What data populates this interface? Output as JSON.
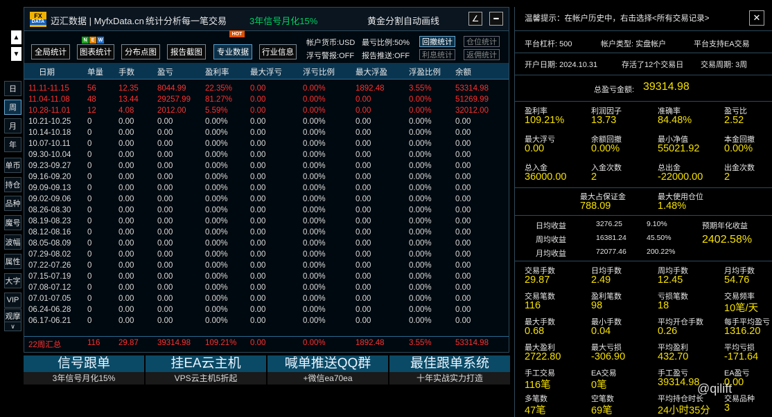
{
  "left_nav": {
    "up": "▲",
    "down": "▼",
    "buttons": [
      "日",
      "周",
      "月",
      "年",
      "单币",
      "持仓",
      "品种",
      "魔号",
      "波幅",
      "属性",
      "大字",
      "VIP",
      "观摩"
    ],
    "more": "∨"
  },
  "title": {
    "logo_top": "FX",
    "logo_bottom": "DATA",
    "app": "迈汇数据 | MyfxData.cn",
    "tagline": "统计分析每一笔交易",
    "promo": "3年信号月化15%",
    "gold": "黄金分割自动画线",
    "btn_edit": "∠",
    "btn_min": "━"
  },
  "tabs": [
    "全局统计",
    "图表统计",
    "分布点图",
    "报告截图",
    "专业数据",
    "行业信息"
  ],
  "badges": {
    "n": "N",
    "e": "E",
    "w": "W",
    "hot": "HOT"
  },
  "info": {
    "currency": "帐户货币:USD",
    "max_loss": "最亏比例:50%",
    "float_warn": "浮亏警报:OFF",
    "report_push": "报告推送:OFF"
  },
  "opt_buttons": [
    "回撤统计",
    "仓位统计",
    "利息统计",
    "返佣统计"
  ],
  "table": {
    "headers": [
      "日期",
      "单量",
      "手数",
      "盈亏",
      "盈利率",
      "最大浮亏",
      "浮亏比例",
      "最大浮盈",
      "浮盈比例",
      "余额"
    ],
    "rows": [
      [
        "11.11-11.15",
        "56",
        "12.35",
        "8044.99",
        "22.35%",
        "0.00",
        "0.00%",
        "1892.48",
        "3.55%",
        "53314.98"
      ],
      [
        "11.04-11.08",
        "48",
        "13.44",
        "29257.99",
        "81.27%",
        "0.00",
        "0.00%",
        "0.00",
        "0.00%",
        "51269.99"
      ],
      [
        "10.28-11.01",
        "12",
        "4.08",
        "2012.00",
        "5.59%",
        "0.00",
        "0.00%",
        "0.00",
        "0.00%",
        "32012.00"
      ],
      [
        "10.21-10.25",
        "0",
        "0.00",
        "0.00",
        "0.00%",
        "0.00",
        "0.00%",
        "0.00",
        "0.00%",
        "0.00"
      ],
      [
        "10.14-10.18",
        "0",
        "0.00",
        "0.00",
        "0.00%",
        "0.00",
        "0.00%",
        "0.00",
        "0.00%",
        "0.00"
      ],
      [
        "10.07-10.11",
        "0",
        "0.00",
        "0.00",
        "0.00%",
        "0.00",
        "0.00%",
        "0.00",
        "0.00%",
        "0.00"
      ],
      [
        "09.30-10.04",
        "0",
        "0.00",
        "0.00",
        "0.00%",
        "0.00",
        "0.00%",
        "0.00",
        "0.00%",
        "0.00"
      ],
      [
        "09.23-09.27",
        "0",
        "0.00",
        "0.00",
        "0.00%",
        "0.00",
        "0.00%",
        "0.00",
        "0.00%",
        "0.00"
      ],
      [
        "09.16-09.20",
        "0",
        "0.00",
        "0.00",
        "0.00%",
        "0.00",
        "0.00%",
        "0.00",
        "0.00%",
        "0.00"
      ],
      [
        "09.09-09.13",
        "0",
        "0.00",
        "0.00",
        "0.00%",
        "0.00",
        "0.00%",
        "0.00",
        "0.00%",
        "0.00"
      ],
      [
        "09.02-09.06",
        "0",
        "0.00",
        "0.00",
        "0.00%",
        "0.00",
        "0.00%",
        "0.00",
        "0.00%",
        "0.00"
      ],
      [
        "08.26-08.30",
        "0",
        "0.00",
        "0.00",
        "0.00%",
        "0.00",
        "0.00%",
        "0.00",
        "0.00%",
        "0.00"
      ],
      [
        "08.19-08.23",
        "0",
        "0.00",
        "0.00",
        "0.00%",
        "0.00",
        "0.00%",
        "0.00",
        "0.00%",
        "0.00"
      ],
      [
        "08.12-08.16",
        "0",
        "0.00",
        "0.00",
        "0.00%",
        "0.00",
        "0.00%",
        "0.00",
        "0.00%",
        "0.00"
      ],
      [
        "08.05-08.09",
        "0",
        "0.00",
        "0.00",
        "0.00%",
        "0.00",
        "0.00%",
        "0.00",
        "0.00%",
        "0.00"
      ],
      [
        "07.29-08.02",
        "0",
        "0.00",
        "0.00",
        "0.00%",
        "0.00",
        "0.00%",
        "0.00",
        "0.00%",
        "0.00"
      ],
      [
        "07.22-07.26",
        "0",
        "0.00",
        "0.00",
        "0.00%",
        "0.00",
        "0.00%",
        "0.00",
        "0.00%",
        "0.00"
      ],
      [
        "07.15-07.19",
        "0",
        "0.00",
        "0.00",
        "0.00%",
        "0.00",
        "0.00%",
        "0.00",
        "0.00%",
        "0.00"
      ],
      [
        "07.08-07.12",
        "0",
        "0.00",
        "0.00",
        "0.00%",
        "0.00",
        "0.00%",
        "0.00",
        "0.00%",
        "0.00"
      ],
      [
        "07.01-07.05",
        "0",
        "0.00",
        "0.00",
        "0.00%",
        "0.00",
        "0.00%",
        "0.00",
        "0.00%",
        "0.00"
      ],
      [
        "06.24-06.28",
        "0",
        "0.00",
        "0.00",
        "0.00%",
        "0.00",
        "0.00%",
        "0.00",
        "0.00%",
        "0.00"
      ],
      [
        "06.17-06.21",
        "0",
        "0.00",
        "0.00",
        "0.00%",
        "0.00",
        "0.00%",
        "0.00",
        "0.00%",
        "0.00"
      ]
    ],
    "total": [
      "22周汇总",
      "116",
      "29.87",
      "39314.98",
      "109.21%",
      "0.00",
      "0.00%",
      "1892.48",
      "3.55%",
      "53314.98"
    ]
  },
  "promos": [
    {
      "title": "信号跟单",
      "sub": "3年信号月化15%"
    },
    {
      "title": "挂EA云主机",
      "sub": "VPS云主机5折起"
    },
    {
      "title": "喊单推送QQ群",
      "sub": "+微信ea70ea"
    },
    {
      "title": "最佳跟单系统",
      "sub": "十年实战实力打造"
    }
  ],
  "right": {
    "tip": "温馨提示：在帐户历史中，右击选择<所有交易记录>",
    "close": "✕",
    "leverage": "平台杠杆:  500",
    "acct_type": "帐户类型:  实盘帐户",
    "ea_support": "平台支持EA交易",
    "open_date": "开户日期:  2024.10.31",
    "trade_days": "存活了12个交易日",
    "period": "交易周期:  3周",
    "total_pl_label": "总盈亏金额:",
    "total_pl": "39314.98",
    "grid1": [
      {
        "label": "盈利率",
        "value": "109.21%"
      },
      {
        "label": "利润因子",
        "value": "13.73"
      },
      {
        "label": "准确率",
        "value": "84.48%"
      },
      {
        "label": "盈亏比",
        "value": "2.52"
      },
      {
        "label": "最大浮亏",
        "value": "0.00"
      },
      {
        "label": "余额回撤",
        "value": "0.00%"
      },
      {
        "label": "最小净值",
        "value": "55021.92"
      },
      {
        "label": "本金回撤",
        "value": "0.00%"
      },
      {
        "label": "总入金",
        "value": "36000.00"
      },
      {
        "label": "入金次数",
        "value": "2"
      },
      {
        "label": "总出金",
        "value": "-22000.00"
      },
      {
        "label": "出金次数",
        "value": "2"
      }
    ],
    "margin": [
      {
        "label": "最大占保证金",
        "value": "788.09"
      },
      {
        "label": "最大使用仓位",
        "value": "1.48%"
      }
    ],
    "returns": [
      {
        "label": "日均收益",
        "amount": "3276.25",
        "pct": "9.10%"
      },
      {
        "label": "周均收益",
        "amount": "16381.24",
        "pct": "45.50%"
      },
      {
        "label": "月均收益",
        "amount": "72077.46",
        "pct": "200.22%"
      }
    ],
    "annual_label": "预期年化收益",
    "annual": "2402.58%",
    "grid2": [
      {
        "label": "交易手数",
        "value": "29.87"
      },
      {
        "label": "日均手数",
        "value": "2.49"
      },
      {
        "label": "周均手数",
        "value": "12.45"
      },
      {
        "label": "月均手数",
        "value": "54.76"
      },
      {
        "label": "交易笔数",
        "value": "116"
      },
      {
        "label": "盈利笔数",
        "value": "98"
      },
      {
        "label": "亏损笔数",
        "value": "18"
      },
      {
        "label": "交易频率",
        "value": "10笔/天"
      },
      {
        "label": "最大手数",
        "value": "0.68"
      },
      {
        "label": "最小手数",
        "value": "0.04"
      },
      {
        "label": "平均开仓手数",
        "value": "0.26"
      },
      {
        "label": "每手平均盈亏",
        "value": "1316.20"
      },
      {
        "label": "最大盈利",
        "value": "2722.80"
      },
      {
        "label": "最大亏损",
        "value": "-306.90"
      },
      {
        "label": "平均盈利",
        "value": "432.70"
      },
      {
        "label": "平均亏损",
        "value": "-171.64"
      },
      {
        "label": "手工交易",
        "value": "116笔"
      },
      {
        "label": "EA交易",
        "value": "0笔"
      },
      {
        "label": "手工盈亏",
        "value": "39314.98"
      },
      {
        "label": "EA盈亏",
        "value": "0.00"
      },
      {
        "label": "多笔数",
        "value": "47笔"
      },
      {
        "label": "空笔数",
        "value": "69笔"
      },
      {
        "label": "平均持仓时长",
        "value": "24小时35分"
      },
      {
        "label": "交易品种",
        "value": "3"
      }
    ]
  },
  "watermark": "@qilift"
}
